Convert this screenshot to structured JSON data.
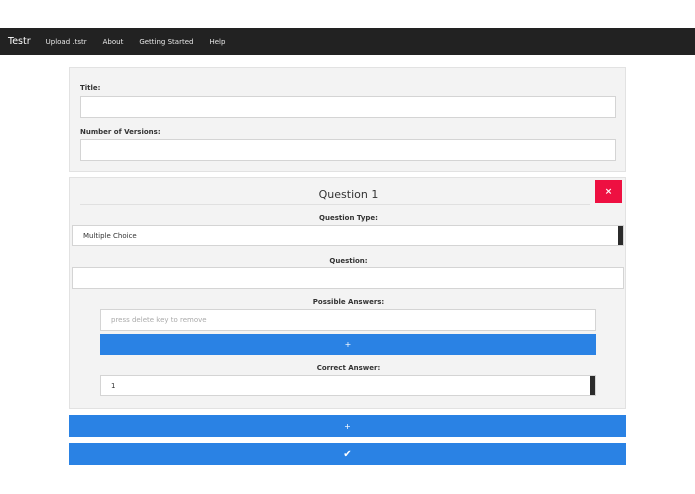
{
  "navbar": {
    "brand": "Testr",
    "links": [
      "Upload .tstr",
      "About",
      "Getting Started",
      "Help"
    ]
  },
  "form": {
    "title_label": "Title:",
    "title_value": "",
    "versions_label": "Number of Versions:",
    "versions_value": ""
  },
  "question": {
    "heading": "Question 1",
    "remove_icon": "×",
    "type_label": "Question Type:",
    "type_value": "Multiple Choice",
    "question_label": "Question:",
    "question_value": "",
    "answers_label": "Possible Answers:",
    "answers_placeholder": "press delete key to remove",
    "add_answer_icon": "+",
    "correct_label": "Correct Answer:",
    "correct_value": "1"
  },
  "actions": {
    "add_question_icon": "+",
    "submit_icon": "✔"
  },
  "colors": {
    "navbar": "#222222",
    "primary": "#2a82e4",
    "danger": "#ee1041",
    "panel": "#f3f3f3"
  }
}
